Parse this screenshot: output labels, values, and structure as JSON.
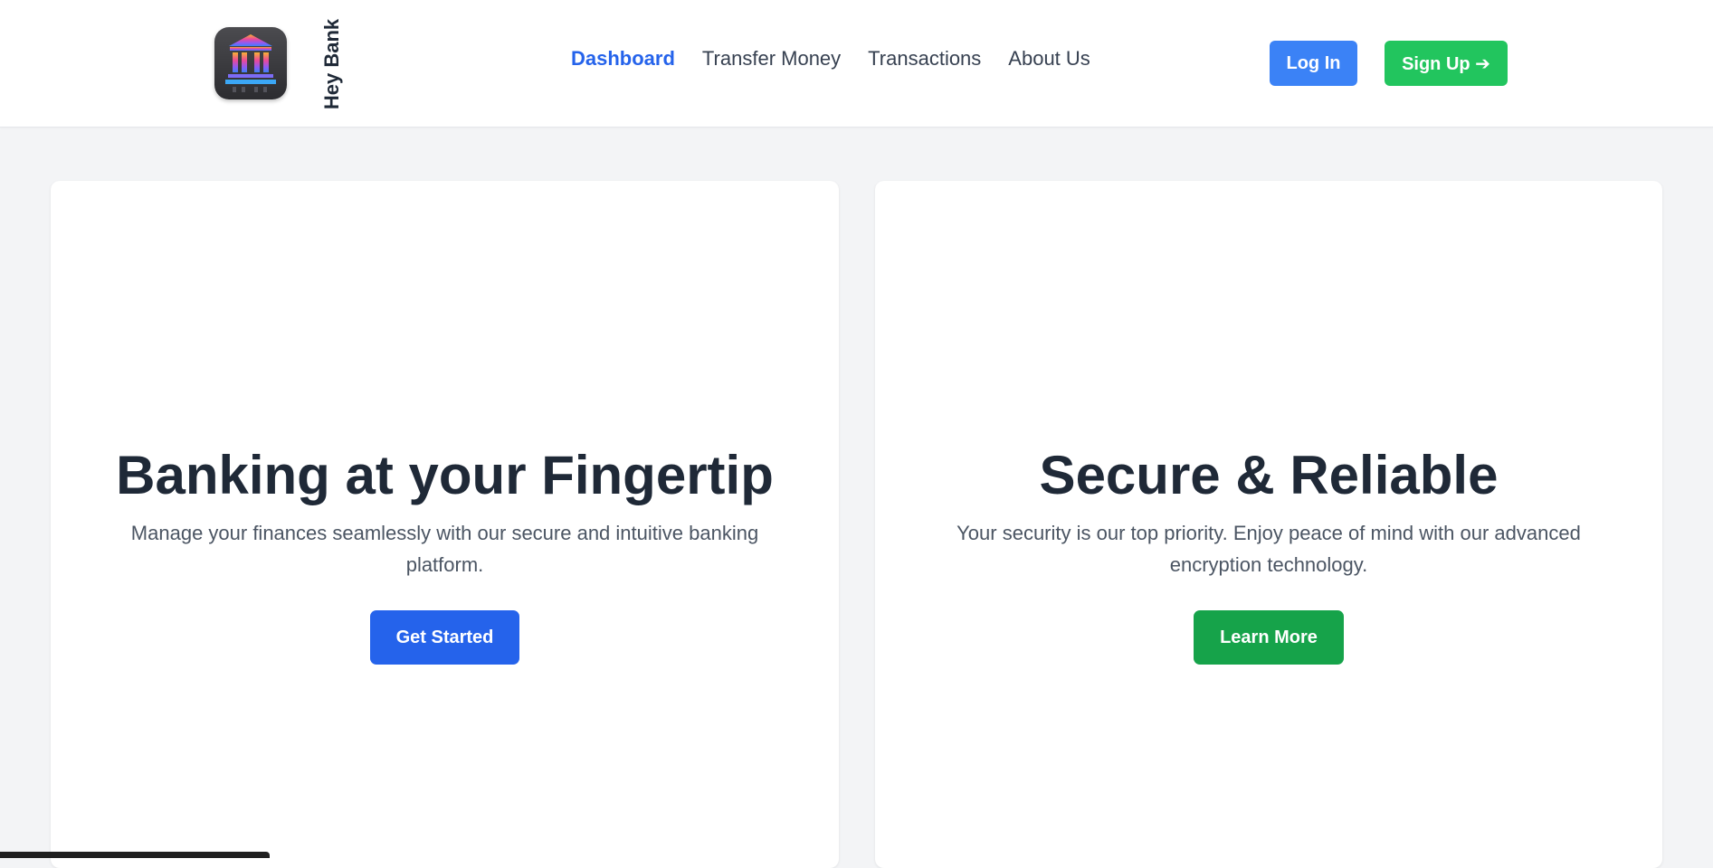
{
  "header": {
    "brand_name": "Hey Bank",
    "logo_icon": "bank-building-icon",
    "nav_items": [
      {
        "label": "Dashboard",
        "active": true
      },
      {
        "label": "Transfer Money",
        "active": false
      },
      {
        "label": "Transactions",
        "active": false
      },
      {
        "label": "About Us",
        "active": false
      }
    ],
    "login_label": "Log In",
    "signup_label": "Sign Up ➔"
  },
  "cards": [
    {
      "title": "Banking at your Fingertip",
      "description": "Manage your finances seamlessly with our secure and intuitive banking platform.",
      "button_label": "Get Started",
      "button_color": "#2563eb"
    },
    {
      "title": "Secure & Reliable",
      "description": "Your security is our top priority. Enjoy peace of mind with our advanced encryption technology.",
      "button_label": "Learn More",
      "button_color": "#16a34a"
    }
  ],
  "colors": {
    "accent_blue": "#2563eb",
    "login_blue": "#3b82f6",
    "signup_green": "#22c55e",
    "cta_green": "#16a34a",
    "page_background": "#f3f4f6"
  }
}
